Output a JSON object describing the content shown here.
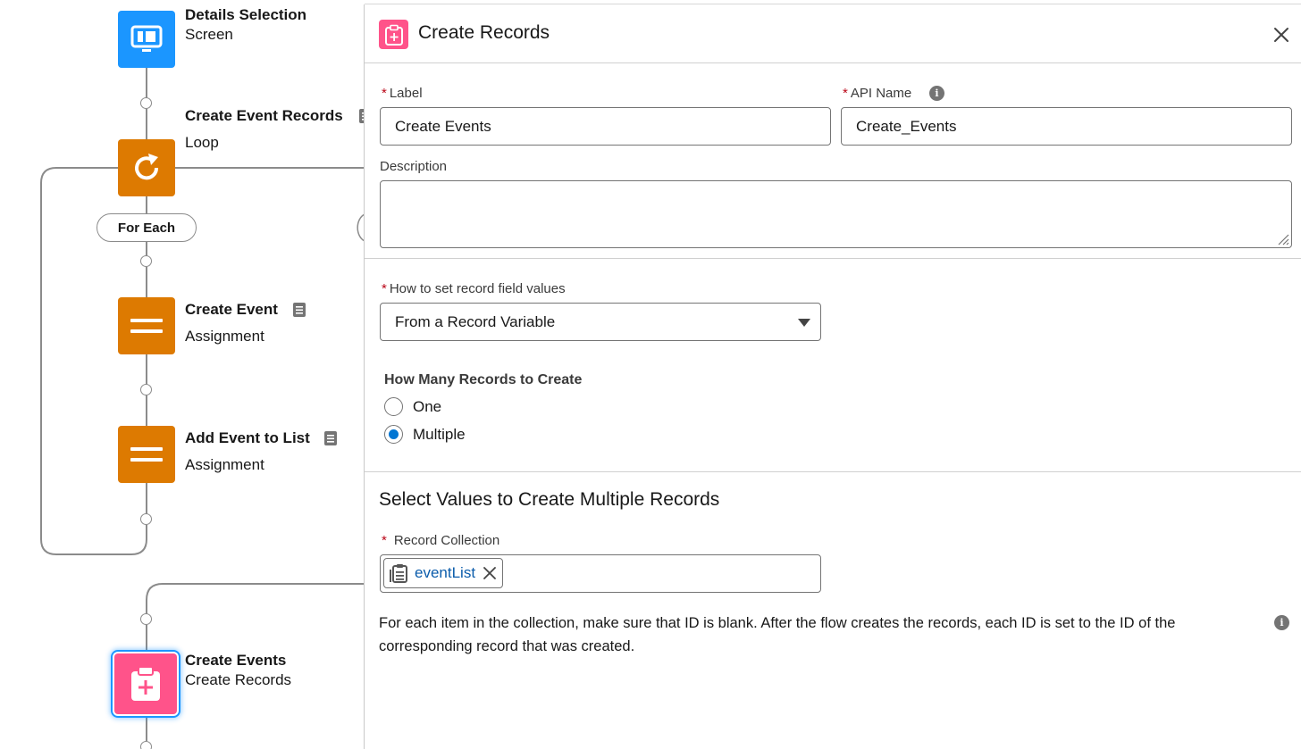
{
  "canvas": {
    "nodes": [
      {
        "title": "Details Selection",
        "type": "Screen",
        "icon": "screen-icon"
      },
      {
        "title": "Create Event Records",
        "type": "Loop",
        "icon": "loop-icon"
      },
      {
        "title": "Create Event",
        "type": "Assignment",
        "icon": "assignment-icon"
      },
      {
        "title": "Add Event to List",
        "type": "Assignment",
        "icon": "assignment-icon"
      },
      {
        "title": "Create Events",
        "type": "Create Records",
        "icon": "create-records-icon"
      }
    ],
    "for_each_label": "For Each"
  },
  "panel": {
    "title": "Create Records",
    "label_field": {
      "label": "Label",
      "value": "Create Events"
    },
    "api_name_field": {
      "label": "API Name",
      "value": "Create_Events"
    },
    "description_field": {
      "label": "Description",
      "value": ""
    },
    "how_to_set": {
      "label": "How to set record field values",
      "value": "From a Record Variable"
    },
    "how_many": {
      "heading": "How Many Records to Create",
      "options": [
        "One",
        "Multiple"
      ],
      "selected": "Multiple"
    },
    "multiple_section": {
      "heading": "Select Values to Create Multiple Records",
      "record_collection_label": "Record Collection",
      "record_collection_value": "eventList"
    },
    "help_text": "For each item in the collection, make sure that ID is blank. After the flow creates the records, each ID is set to the ID of the corresponding record that was created.",
    "colors": {
      "accent": "#0176d3",
      "required": "#ba0517",
      "create_records": "#ff538a",
      "loop_assignment": "#dd7a01",
      "screen": "#1b96ff"
    }
  }
}
